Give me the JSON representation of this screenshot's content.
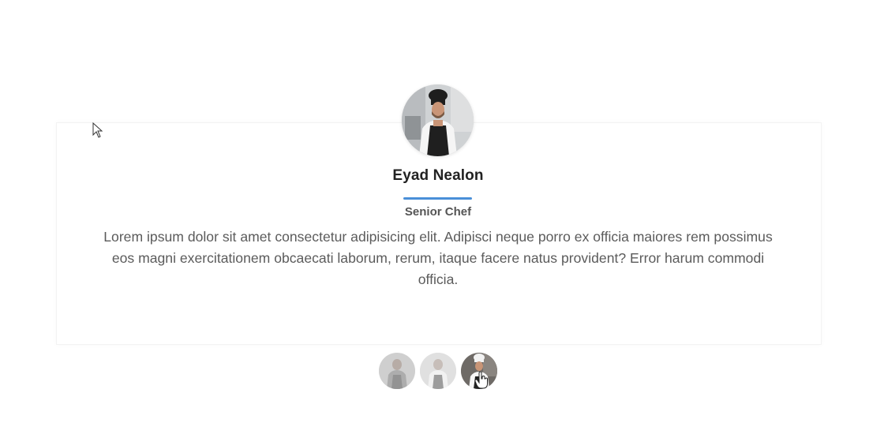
{
  "testimonial": {
    "name": "Eyad Nealon",
    "role": "Senior Chef",
    "quote": "Lorem ipsum dolor sit amet consectetur adipisicing elit. Adipisci neque porro ex officia maiores rem possimus eos magni exercitationem obcaecati laborum, rerum, itaque facere natus provident? Error harum commodi officia.",
    "accent_color": "#4a8fd8"
  },
  "thumbnails": [
    {
      "icon": "person-photo",
      "active": false
    },
    {
      "icon": "person-photo",
      "active": false
    },
    {
      "icon": "chef-photo",
      "active": true
    }
  ]
}
